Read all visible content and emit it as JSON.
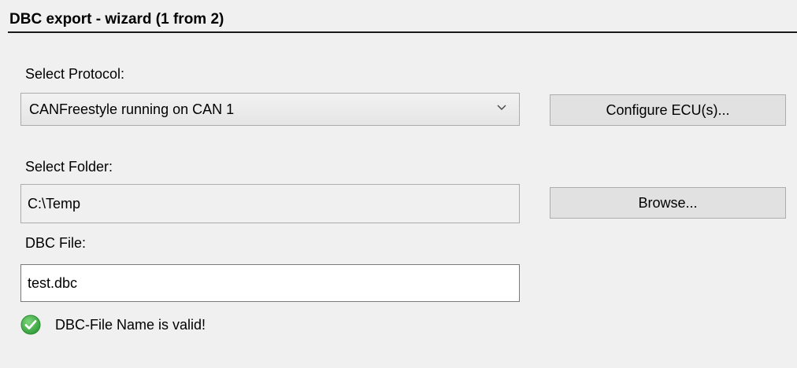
{
  "window": {
    "title": "DBC export -  wizard (1 from 2)"
  },
  "protocol": {
    "label": "Select Protocol:",
    "selected": "CANFreestyle running on CAN 1",
    "configure_button": "Configure ECU(s)..."
  },
  "folder": {
    "label": "Select Folder:",
    "value": "C:\\Temp",
    "browse_button": "Browse..."
  },
  "file": {
    "label": "DBC File:",
    "value": "test.dbc"
  },
  "status": {
    "text": "DBC-File Name is valid!",
    "icon": "check-circle-icon",
    "color": "#3cb043"
  }
}
